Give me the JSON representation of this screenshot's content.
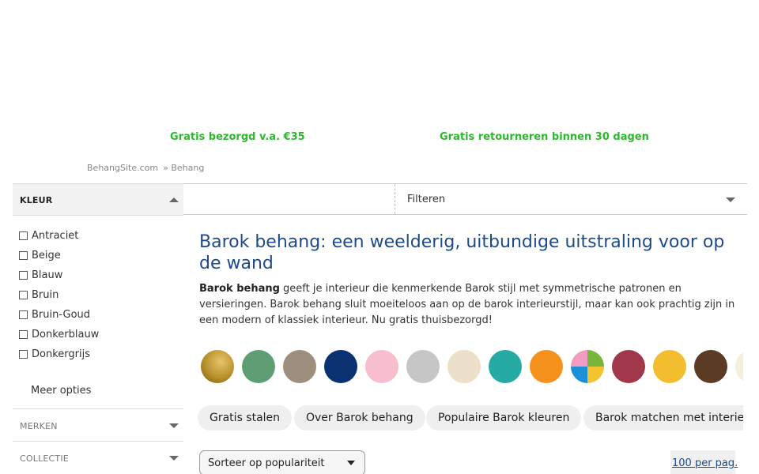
{
  "usp": {
    "free_delivery": "Gratis bezorgd v.a. €35",
    "free_returns": "Gratis retourneren binnen 30 dagen"
  },
  "breadcrumb": {
    "home": "BehangSite.com",
    "current": "» Behang"
  },
  "sidebar": {
    "color_filter": {
      "label": "KLEUR",
      "options": [
        "Antraciet",
        "Beige",
        "Blauw",
        "Bruin",
        "Bruin-Goud",
        "Donkerblauw",
        "Donkergrijs"
      ],
      "more": "Meer opties"
    },
    "brands_label": "MERKEN",
    "collection_label": "COLLECTIE"
  },
  "filter_bar": {
    "label": "Filteren"
  },
  "main": {
    "title": "Barok behang: een weelderig, uitbundige uitstraling voor op de wand",
    "intro_bold": "Barok behang",
    "intro_text": " geeft je interieur die kenmerkende Barok stijl met symmetrische patronen en versieringen. Barok behang sluit moeiteloos aan op de barok interieurstijl, maar kan ook prachtig zijn in een modern of klassiek interieur. Nu gratis thuisbezorgd!"
  },
  "swatch_colors": [
    "#b8902a",
    "#5e9e74",
    "#9e8e7e",
    "#0a3270",
    "#f7bfcd",
    "#c6c6c6",
    "#ede0c8",
    "#26aaa4",
    "#f5921e",
    "multicolor",
    "#a0374a",
    "#f2bd2e",
    "#5b3b24",
    "#f3eedd"
  ],
  "chips": [
    "Gratis stalen",
    "Over Barok behang",
    "Populaire Barok kleuren",
    "Barok matchen met interieur"
  ],
  "sort": {
    "selected": "Sorteer op populariteit"
  },
  "per_page": "100 per pag."
}
